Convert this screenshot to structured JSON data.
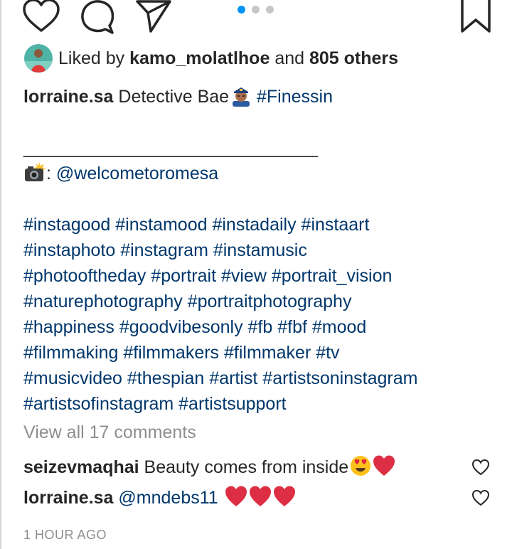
{
  "post": {
    "carousel": {
      "count": 3,
      "active_index": 0,
      "active_color": "#0095f6"
    },
    "likes": {
      "prefix": "Liked by",
      "user": "kamo_molatlhoe",
      "middle": "and",
      "others": "805 others"
    },
    "caption": {
      "user": "lorraine.sa",
      "text": "Detective Bae",
      "emoji_icon": "police-officer-emoji",
      "hashtag": "#Finessin",
      "rule": "________________________________",
      "photo_credit_icon": "camera-flash-emoji",
      "photo_credit_sep": ":",
      "photo_credit_mention": "@welcometoromesa",
      "hashtag_lines": [
        "#instagood #instamood #instadaily #instaart",
        "#instaphoto #instagram #instamusic",
        "#photooftheday #portrait #view #portrait_vision",
        "#naturephotography #portraitphotography",
        "#happiness #goodvibesonly #fb #fbf #mood",
        "#filmmaking #filmmakers #filmmaker #tv",
        "#musicvideo #thespian #artist #artistsoninstagram",
        "#artistsofinstagram #artistsupport"
      ]
    },
    "view_all_comments": "View all 17 comments",
    "comments": [
      {
        "user": "seizevmaqhai",
        "text": "Beauty comes from inside",
        "emojis": [
          "heart-eyes-emoji",
          "red-heart-emoji"
        ]
      },
      {
        "user": "lorraine.sa",
        "text": "@mndebs11",
        "emojis": [
          "red-heart-emoji",
          "red-heart-emoji",
          "red-heart-emoji"
        ]
      }
    ],
    "timestamp": "1 HOUR AGO"
  }
}
